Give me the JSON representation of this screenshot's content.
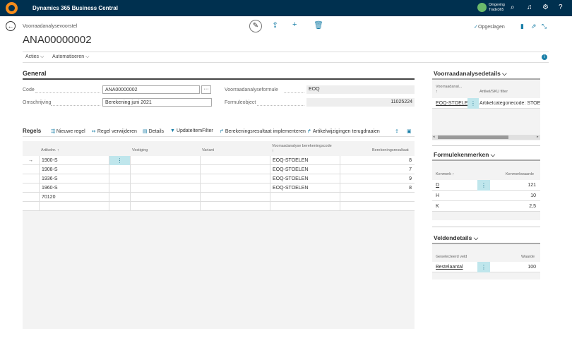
{
  "app": {
    "title": "Dynamics 365 Business Central",
    "environment": [
      "Omgeving",
      "Trade365"
    ]
  },
  "page": {
    "breadcrumb": "Voorraadanalysevoorstel",
    "title": "ANA00000002",
    "saved_label": "Opgeslagen"
  },
  "menu": [
    "Acties",
    "Automatiseren"
  ],
  "general": {
    "title": "General",
    "code_label": "Code",
    "code_value": "ANA00000002",
    "desc_label": "Omschrijving",
    "desc_value": "Berekening juni 2021",
    "formula_label": "Voorraadanalyseformule",
    "formula_value": "EOQ",
    "obj_label": "Formuleobject",
    "obj_value": "11025224"
  },
  "lines": {
    "title": "Regels",
    "actions": [
      "Nieuwe regel",
      "Regel verwijderen",
      "Details",
      "UpdateItemFilter",
      "Berekeningsresultaat implementeren",
      "Artikelwijzigingen terugdraaien"
    ],
    "columns": [
      "Artikelnr. ↑",
      "Vestiging",
      "Variant",
      "Voorraadanalyse berekeningscode",
      "↑",
      "Berekeningsresultaat"
    ],
    "rows": [
      {
        "item": "1900-S",
        "location": "",
        "variant": "",
        "code": "EOQ-STOELEN",
        "result": "8"
      },
      {
        "item": "1908-S",
        "location": "",
        "variant": "",
        "code": "EOQ-STOELEN",
        "result": "7"
      },
      {
        "item": "1936-S",
        "location": "",
        "variant": "",
        "code": "EOQ-STOELEN",
        "result": "9"
      },
      {
        "item": "1960-S",
        "location": "",
        "variant": "",
        "code": "EOQ-STOELEN",
        "result": "8"
      },
      {
        "item": "70120",
        "location": "",
        "variant": "",
        "code": "",
        "result": ""
      }
    ]
  },
  "factbox1": {
    "title": "Voorraadanalysedetails",
    "col1": "Voorraadanal...",
    "col1b": "↑",
    "col2": "Artikel/SKU filter",
    "rows": [
      {
        "code": "EOQ-STOELEN",
        "filter": "Artikelcategoriecode: STOEL"
      }
    ]
  },
  "factbox2": {
    "title": "Formulekenmerken",
    "col1": "Kenmerk ↑",
    "col2": "Kenmerkwaarde",
    "rows": [
      {
        "key": "D",
        "value": "121"
      },
      {
        "key": "H",
        "value": "10"
      },
      {
        "key": "K",
        "value": "2,5"
      }
    ]
  },
  "factbox3": {
    "title": "Veldendetails",
    "col1": "Geselecteerd veld",
    "col2": "Waarde",
    "rows": [
      {
        "field": "Bestelaantal",
        "value": "100"
      }
    ]
  },
  "icons": {
    "accent": "#1a7fa8",
    "topbar": "#00304f"
  }
}
